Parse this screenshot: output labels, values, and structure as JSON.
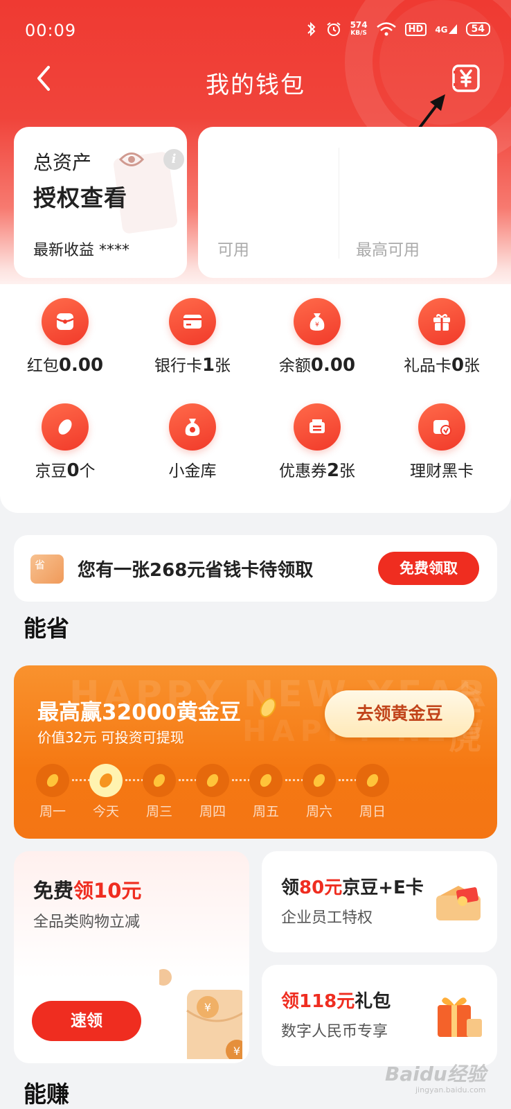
{
  "status_bar": {
    "time": "00:09",
    "speed_value": "574",
    "speed_unit": "KB/S",
    "hd": "HD",
    "signal": "4G",
    "battery": "54"
  },
  "nav": {
    "title": "我的钱包"
  },
  "asset": {
    "label": "总资产",
    "value": "授权查看",
    "income_label": "最新收益 ****"
  },
  "credit": {
    "available_label": "可用",
    "max_label": "最高可用"
  },
  "grid": [
    {
      "label": "红包",
      "value": "0.00",
      "icon": "red-packet-icon"
    },
    {
      "label": "银行卡",
      "value": "1",
      "suffix": "张",
      "icon": "bank-card-icon"
    },
    {
      "label": "余额",
      "value": "0.00",
      "icon": "money-bag-icon"
    },
    {
      "label": "礼品卡",
      "value": "0",
      "suffix": "张",
      "icon": "gift-icon"
    },
    {
      "label": "京豆",
      "value": "0",
      "suffix": "个",
      "icon": "bean-icon"
    },
    {
      "label": "小金库",
      "value": "",
      "icon": "vault-icon"
    },
    {
      "label": "优惠券",
      "value": "2",
      "suffix": "张",
      "icon": "coupon-icon"
    },
    {
      "label": "理财黑卡",
      "value": "",
      "icon": "vip-card-icon"
    }
  ],
  "promo": {
    "icon_text": "省",
    "text_prefix": "您有一张",
    "text_amount": "268",
    "text_suffix": "元省钱卡待领取",
    "button": "免费领取"
  },
  "section_save": "能省",
  "gold": {
    "title": "最高赢32000黄金豆",
    "subtitle": "价值32元 可投资可提现",
    "button": "去领黄金豆",
    "watermark": "HAPPY NEW YEAR",
    "watermark_side": "金虎",
    "days": [
      "周一",
      "今天",
      "周三",
      "周四",
      "周五",
      "周六",
      "周日"
    ]
  },
  "coupon_main": {
    "title_prefix": "免费",
    "title_highlight": "领10元",
    "subtitle": "全品类购物立减",
    "button": "速领"
  },
  "card_beans": {
    "title_prefix": "领",
    "title_highlight": "80元",
    "title_suffix": "京豆+E卡",
    "subtitle": "企业员工特权"
  },
  "card_gift": {
    "title_highlight": "领118元",
    "title_suffix": "礼包",
    "subtitle": "数字人民币专享"
  },
  "section_earn": "能赚",
  "watermark": {
    "brand": "Baidu经验",
    "url": "jingyan.baidu.com"
  },
  "colors": {
    "primary_red": "#ef2d20",
    "gold_orange": "#f57812"
  }
}
